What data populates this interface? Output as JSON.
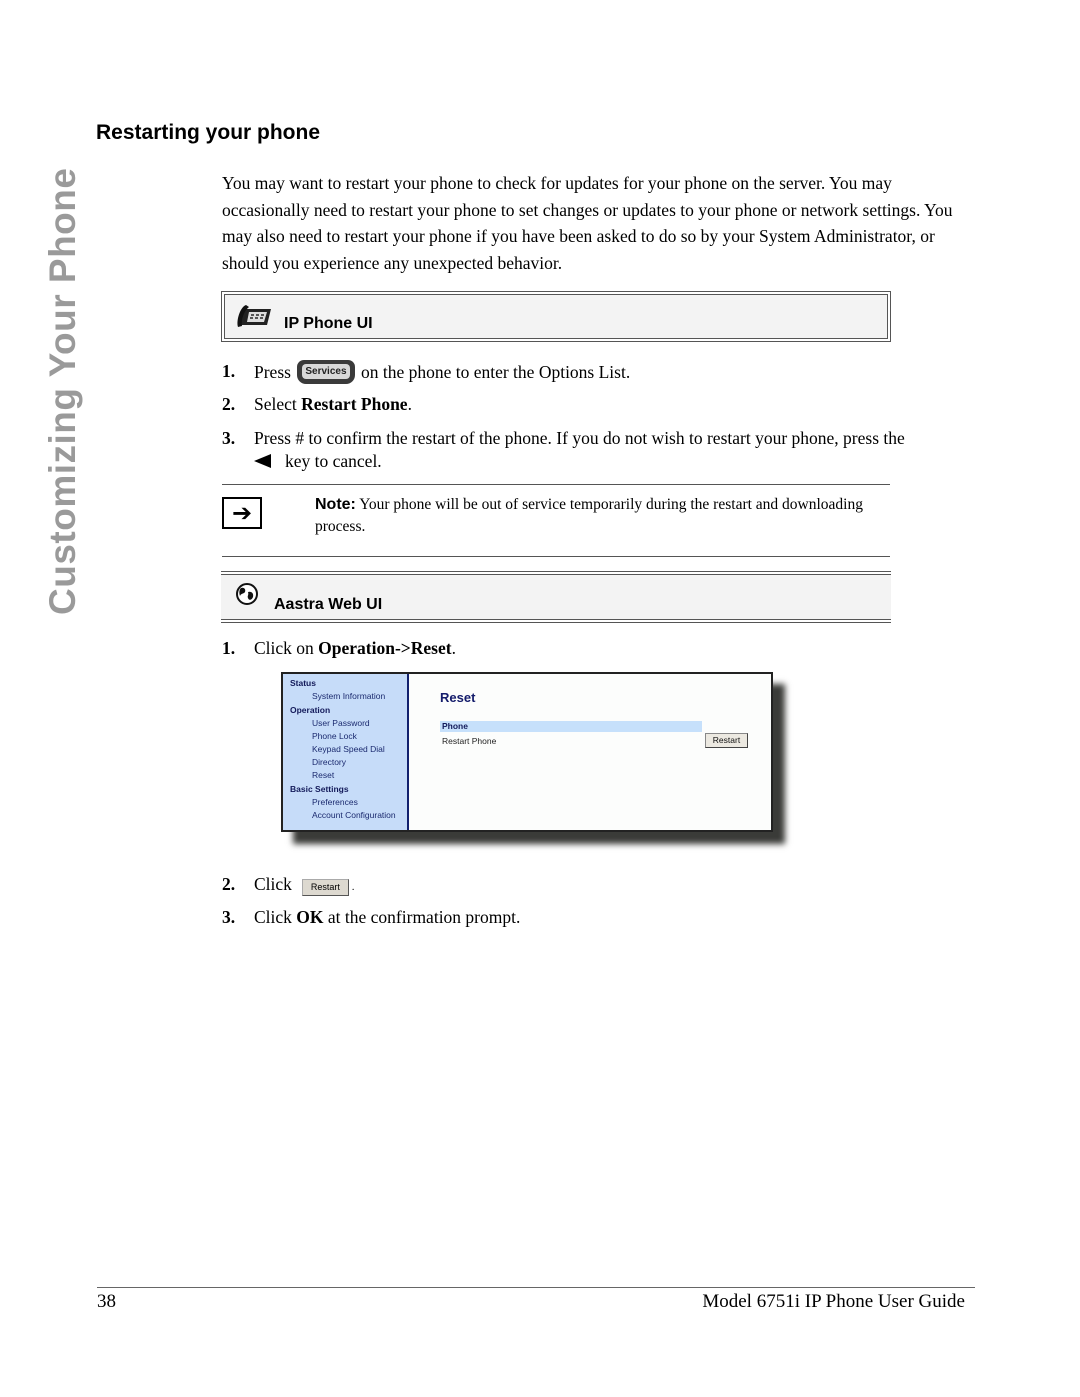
{
  "side_tab": "Customizing Your Phone",
  "section_title": "Restarting your phone",
  "intro": "You may want to restart your phone to check for updates for your phone on the server. You may occasionally need to restart your phone to set changes or updates to your phone or network settings.   You may also need to restart your phone if you have been asked to do so by your System Administrator, or should you experience any unexpected behavior.",
  "ip_phone_ui": {
    "header": "IP Phone UI",
    "icon": "desk-phone-icon",
    "steps": [
      {
        "num": "1.",
        "pre": "Press",
        "button": "Services",
        "post": "on the phone to enter the Options List."
      },
      {
        "num": "2.",
        "pre": "Select ",
        "bold": "Restart Phone",
        "post": "."
      },
      {
        "num": "3.",
        "line1": "Press # to confirm the restart of the phone. If you do not wish to restart your phone, press the",
        "line2": "key to cancel."
      }
    ]
  },
  "note": {
    "icon": "arrow-right-icon",
    "label": "Note:",
    "text": " Your phone will be out of service temporarily during the restart and downloading process."
  },
  "aastra_web_ui": {
    "header": "Aastra Web UI",
    "icon": "globe-icon",
    "steps": [
      {
        "num": "1.",
        "pre": "Click on ",
        "bold": "Operation->Reset",
        "post": "."
      },
      {
        "num": "2.",
        "pre": "Click",
        "button": "Restart",
        "post": "."
      },
      {
        "num": "3.",
        "pre": "Click ",
        "bold": "OK",
        "post": " at the confirmation prompt."
      }
    ],
    "screenshot": {
      "nav": [
        {
          "type": "hdr",
          "label": "Status"
        },
        {
          "type": "sub",
          "label": "System Information"
        },
        {
          "type": "hdr",
          "label": "Operation"
        },
        {
          "type": "sub",
          "label": "User Password"
        },
        {
          "type": "sub",
          "label": "Phone Lock"
        },
        {
          "type": "sub",
          "label": "Keypad Speed Dial"
        },
        {
          "type": "sub",
          "label": "Directory"
        },
        {
          "type": "sub",
          "label": "Reset"
        },
        {
          "type": "hdr",
          "label": "Basic Settings"
        },
        {
          "type": "sub",
          "label": "Preferences"
        },
        {
          "type": "sub",
          "label": "Account Configuration"
        }
      ],
      "title": "Reset",
      "section": "Phone",
      "row_label": "Restart Phone",
      "button": "Restart"
    }
  },
  "footer": {
    "page_number": "38",
    "doc_title": "Model 6751i IP Phone User Guide"
  }
}
